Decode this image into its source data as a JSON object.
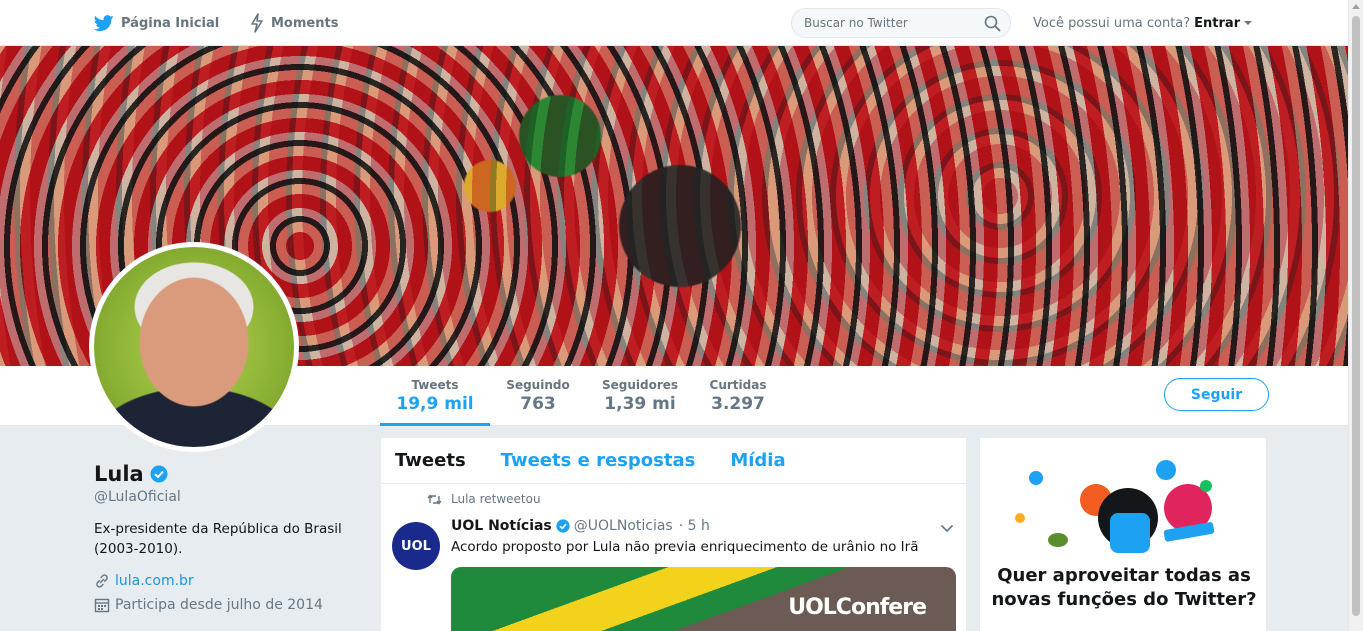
{
  "topnav": {
    "home_label": "Página Inicial",
    "moments_label": "Moments",
    "search_placeholder": "Buscar no Twitter",
    "account_question": "Você possui uma conta?",
    "login_label": "Entrar"
  },
  "profile_nav": {
    "stats": [
      {
        "label": "Tweets",
        "value": "19,9 mil"
      },
      {
        "label": "Seguindo",
        "value": "763"
      },
      {
        "label": "Seguidores",
        "value": "1,39 mi"
      },
      {
        "label": "Curtidas",
        "value": "3.297"
      }
    ],
    "follow_label": "Seguir"
  },
  "profile": {
    "name": "Lula",
    "handle": "@LulaOficial",
    "bio": "Ex-presidente da República do Brasil (2003-2010).",
    "website": "lula.com.br",
    "joined": "Participa desde julho de 2014"
  },
  "timeline": {
    "tabs": [
      "Tweets",
      "Tweets e respostas",
      "Mídia"
    ],
    "tweet": {
      "retweet_context": "Lula retweetou",
      "avatar_text": "UOL",
      "author": "UOL Notícias",
      "handle": "@UOLNoticias",
      "time": "· 5 h",
      "text": "Acordo proposto por Lula não previa enriquecimento de urânio no Irã",
      "media_label": "UOLConfere"
    }
  },
  "promo": {
    "title": "Quer aproveitar todas as novas funções do Twitter?"
  },
  "colors": {
    "accent": "#1da1f2",
    "link": "#1b95e0",
    "background": "#e6ecf0"
  },
  "icons": [
    "twitter-bird-icon",
    "lightning-icon",
    "search-icon",
    "caret-down-icon",
    "verified-icon",
    "link-icon",
    "calendar-icon",
    "retweet-icon",
    "chevron-down-icon"
  ]
}
